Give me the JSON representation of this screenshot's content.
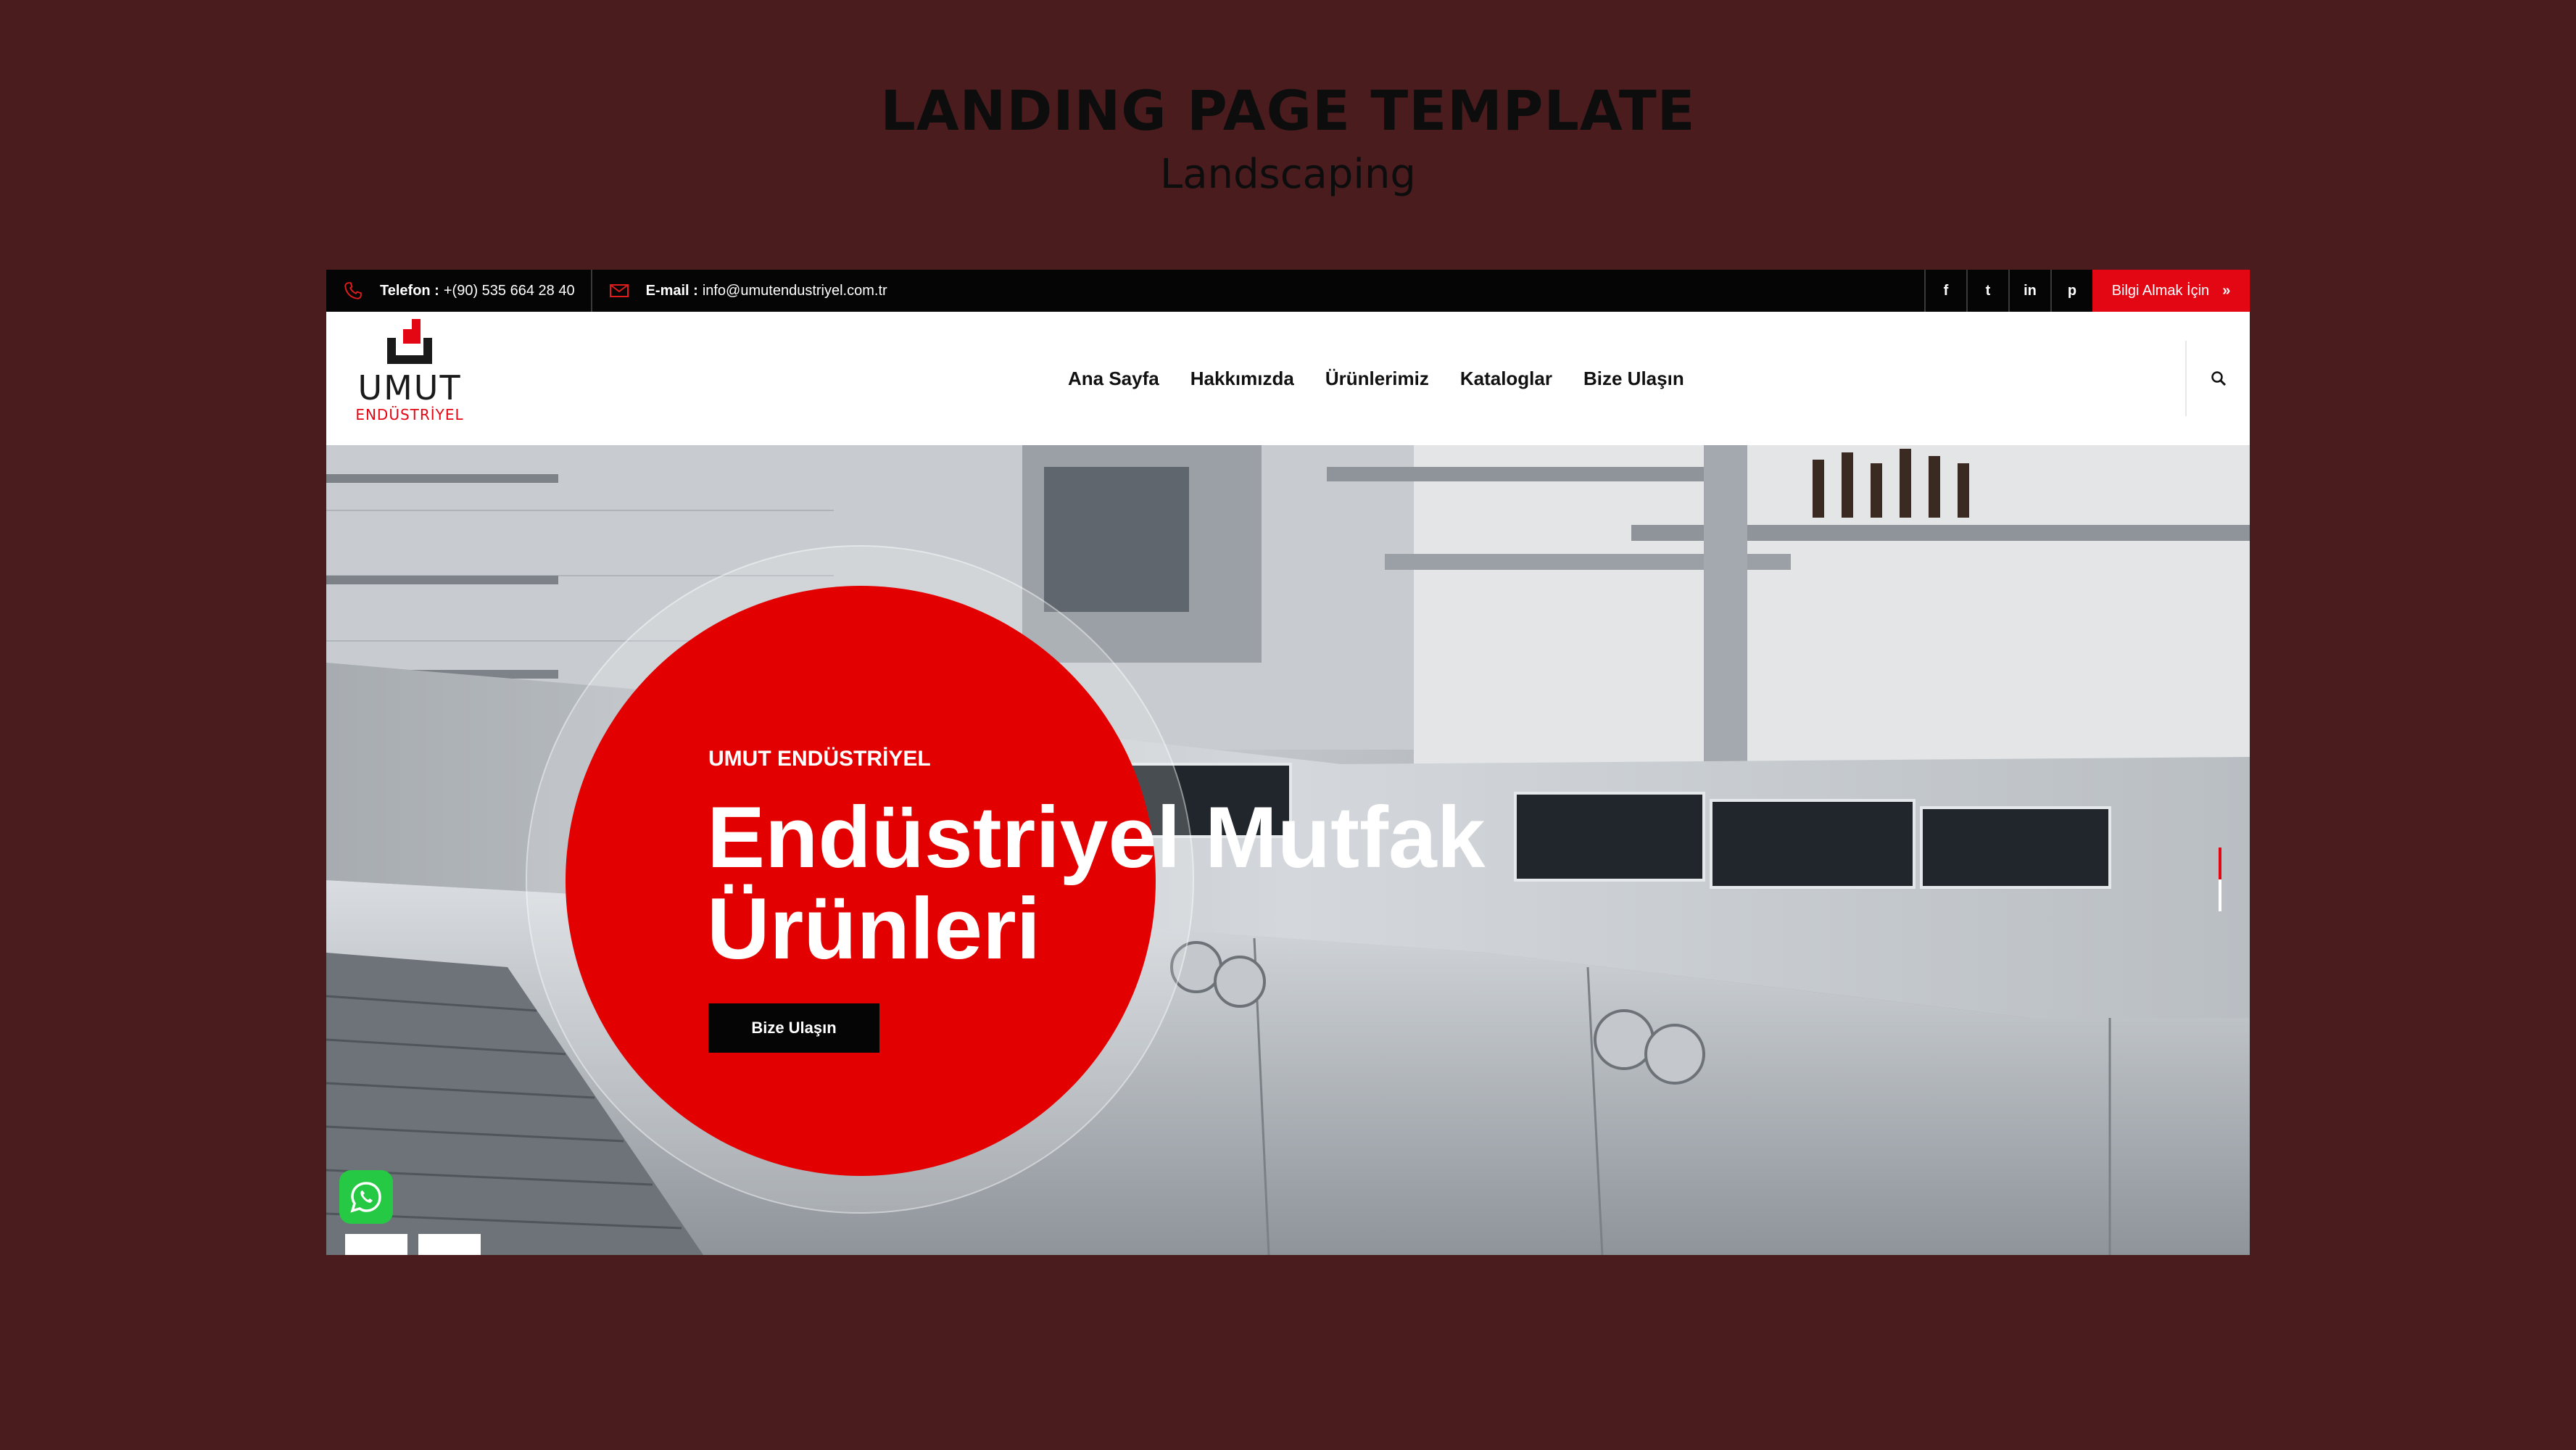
{
  "heading": {
    "title": "LANDING PAGE TEMPLATE",
    "subtitle": "Landscaping"
  },
  "topbar": {
    "phone_label": "Telefon :",
    "phone_value": "+(90) 535 664 28 40",
    "email_label": "E-mail :",
    "email_value": "info@umutendustriyel.com.tr",
    "social": [
      {
        "icon": "facebook-icon",
        "glyph": "f"
      },
      {
        "icon": "twitter-icon",
        "glyph": "t"
      },
      {
        "icon": "linkedin-icon",
        "glyph": "in"
      },
      {
        "icon": "pinterest-icon",
        "glyph": "p"
      }
    ],
    "cta_label": "Bilgi Almak İçin",
    "cta_icon": "double-chevron-right-icon"
  },
  "header": {
    "logo_word": "UMUT",
    "logo_sub": "ENDÜSTRİYEL",
    "nav": [
      "Ana Sayfa",
      "Hakkımızda",
      "Ürünlerimiz",
      "Kataloglar",
      "Bize Ulaşın"
    ],
    "search_icon": "search-icon"
  },
  "hero": {
    "kicker": "UMUT ENDÜSTRİYEL",
    "headline_line1": "Endüstriyel Mutfak",
    "headline_line2": "Ürünleri",
    "button_label": "Bize Ulaşın",
    "active_slide_fraction": 0.5
  },
  "colors": {
    "background": "#4a1c1e",
    "accent": "#e30613",
    "disc": "#e30000",
    "whatsapp": "#26c943"
  },
  "floating": {
    "whatsapp_icon": "whatsapp-icon"
  }
}
